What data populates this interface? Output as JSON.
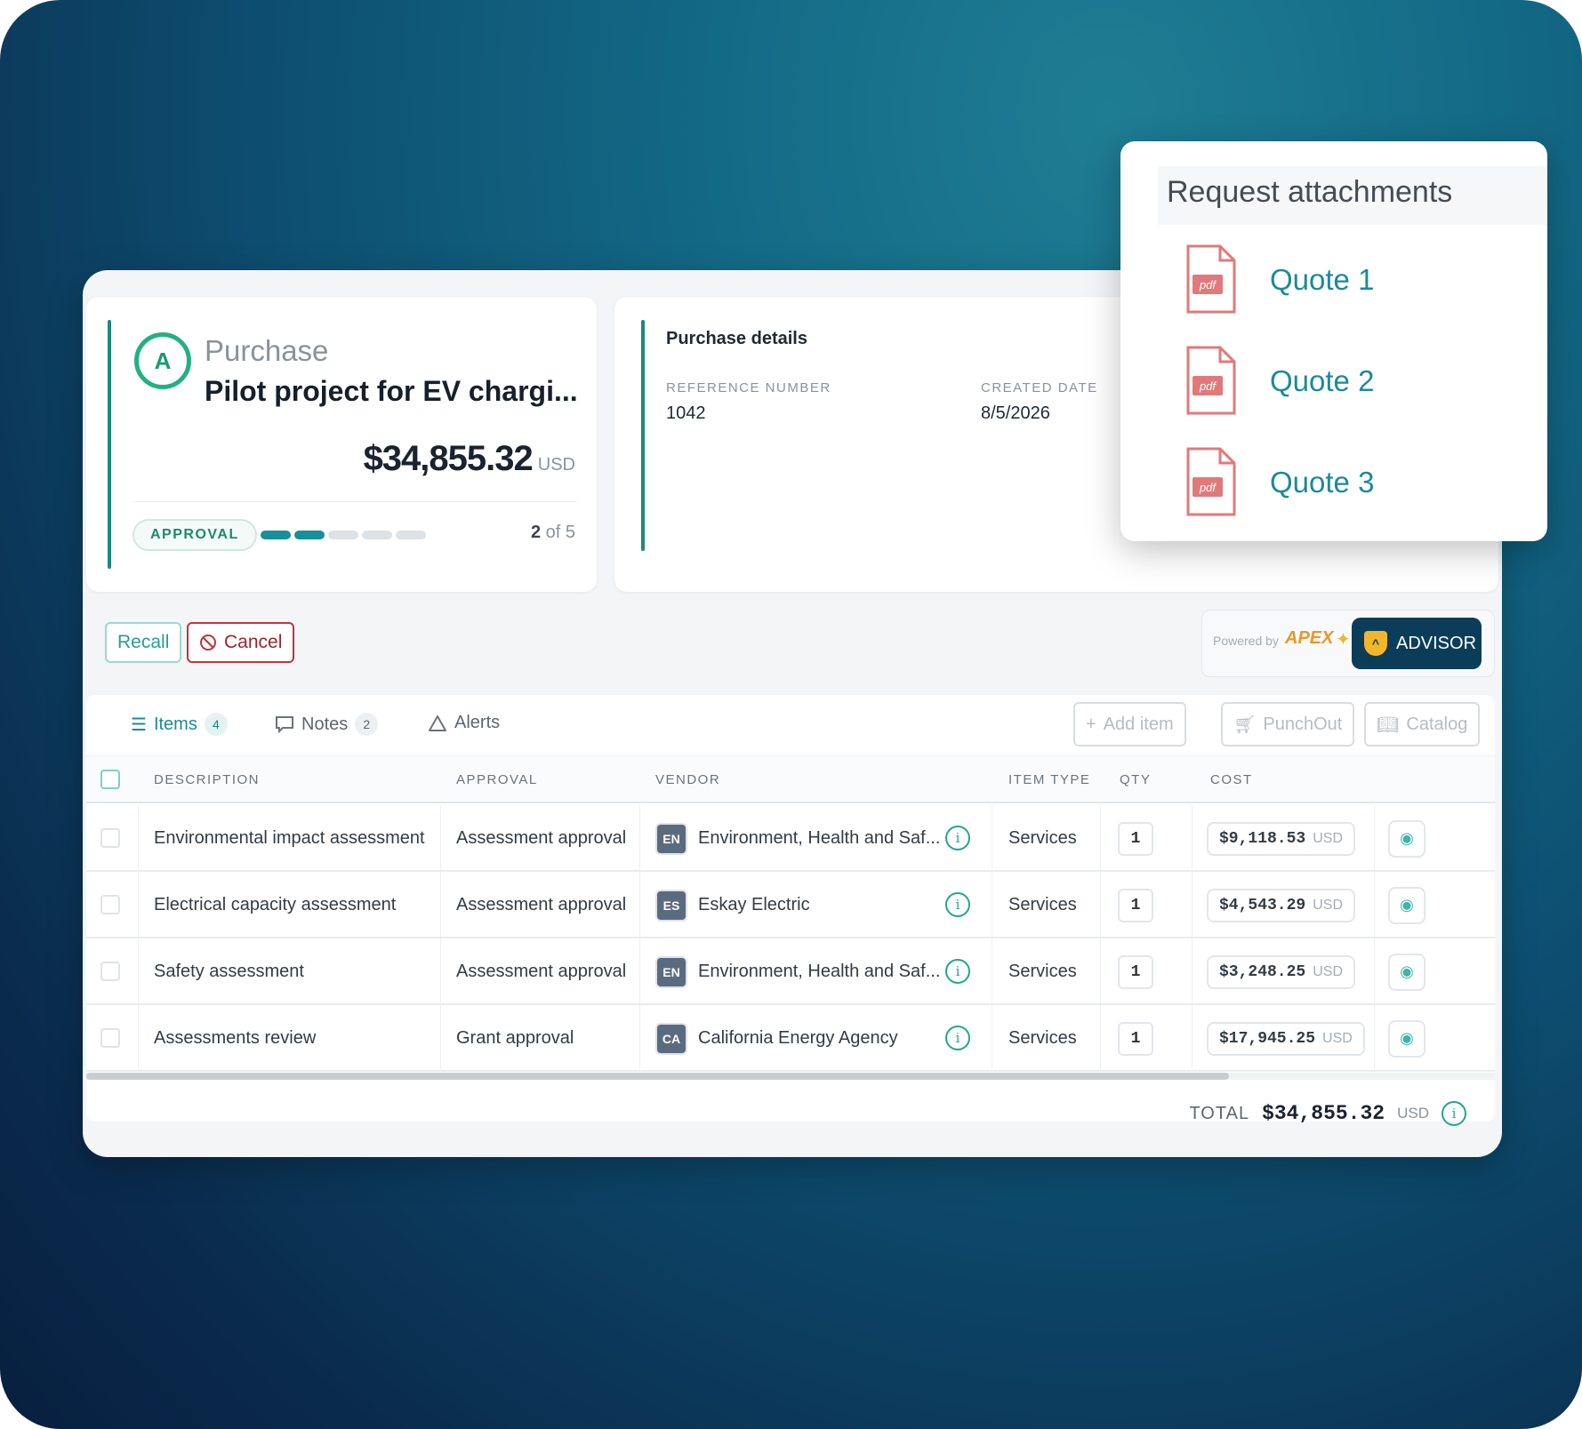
{
  "purchase": {
    "avatar": "A",
    "kind": "Purchase",
    "title": "Pilot project for EV chargi...",
    "amount": "$34,855.32",
    "currency": "USD",
    "stage": "APPROVAL",
    "step_current": "2",
    "step_of": " of 5",
    "steps_done": 2,
    "steps_total": 5
  },
  "details": {
    "title": "Purchase details",
    "ref_label": "REFERENCE NUMBER",
    "ref_value": "1042",
    "created_label": "CREATED DATE",
    "created_value": "8/5/2026"
  },
  "actions": {
    "recall": "Recall",
    "cancel": "Cancel",
    "powered_by": "Powered by",
    "apex": "APEX",
    "advisor": "ADVISOR"
  },
  "tabs": [
    {
      "label": "Items",
      "count": "4"
    },
    {
      "label": "Notes",
      "count": "2"
    },
    {
      "label": "Alerts"
    }
  ],
  "toolbar": {
    "add_item": "Add item",
    "punchout": "PunchOut",
    "catalog": "Catalog"
  },
  "columns": {
    "description": "DESCRIPTION",
    "approval": "APPROVAL",
    "vendor": "VENDOR",
    "item_type": "ITEM TYPE",
    "qty": "QTY",
    "cost": "COST"
  },
  "rows": [
    {
      "description": "Environmental impact assessment",
      "approval": "Assessment approval",
      "vendor_code": "EN",
      "vendor": "Environment, Health and Saf...",
      "item_type": "Services",
      "qty": "1",
      "cost": "$9,118.53",
      "currency": "USD"
    },
    {
      "description": "Electrical capacity assessment",
      "approval": "Assessment approval",
      "vendor_code": "ES",
      "vendor": "Eskay Electric",
      "item_type": "Services",
      "qty": "1",
      "cost": "$4,543.29",
      "currency": "USD"
    },
    {
      "description": "Safety assessment",
      "approval": "Assessment approval",
      "vendor_code": "EN",
      "vendor": "Environment, Health and Saf...",
      "item_type": "Services",
      "qty": "1",
      "cost": "$3,248.25",
      "currency": "USD"
    },
    {
      "description": "Assessments review",
      "approval": "Grant approval",
      "vendor_code": "CA",
      "vendor": "California Energy Agency",
      "item_type": "Services",
      "qty": "1",
      "cost": "$17,945.25",
      "currency": "USD"
    }
  ],
  "total": {
    "label": "TOTAL",
    "value": "$34,855.32",
    "currency": "USD"
  },
  "attachments": {
    "title": "Request attachments",
    "file_type": "pdf",
    "files": [
      "Quote 1",
      "Quote 2",
      "Quote 3"
    ]
  },
  "colors": {
    "accent": "#1b8a9a",
    "advisor_bg": "#0b3d59",
    "cancel": "#c0343c",
    "pdf": "#e07a7a"
  }
}
